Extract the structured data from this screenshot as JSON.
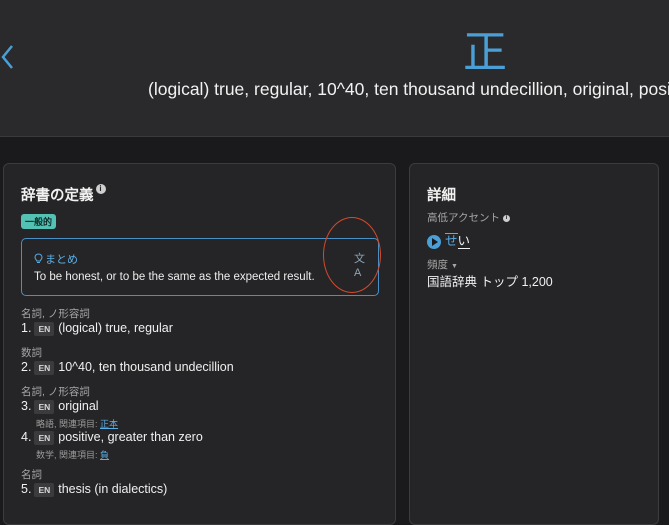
{
  "header": {
    "kanji": "正",
    "gloss": "(logical) true, regular, 10^40, ten thousand undecillion, original, positive, greater than zero"
  },
  "dictionary": {
    "title": "辞書の定義",
    "badge": "一般的",
    "summary_label": "まとめ",
    "summary_text": "To be honest, or to be the same as the expected result.",
    "en_label": "EN",
    "pos": [
      "名詞, ノ形容詞",
      "数詞",
      "名詞, ノ形容詞",
      "名詞"
    ],
    "definitions": [
      {
        "num": "1.",
        "text": "(logical) true, regular"
      },
      {
        "num": "2.",
        "text": "10^40, ten thousand undecillion"
      },
      {
        "num": "3.",
        "text": "original"
      },
      {
        "num": "4.",
        "text": "positive, greater than zero"
      },
      {
        "num": "5.",
        "text": "thesis (in dialectics)"
      }
    ],
    "sub3_prefix": "略語, 関連項目: ",
    "sub3_link": "正本",
    "sub4_prefix": "数学, 関連項目: ",
    "sub4_link": "負"
  },
  "details": {
    "title": "詳細",
    "accent_label": "高低アクセント",
    "accent_hi": "せ",
    "accent_lo": "い",
    "freq_label": "頻度",
    "freq_text": "国語辞典 トップ 1,200"
  },
  "colors": {
    "accent": "#4a9fd6",
    "badge": "#53c2b4",
    "annotation": "#d24a2c"
  },
  "icons": [
    "chevron-left-icon",
    "info-icon",
    "lightbulb-icon",
    "translate-icon",
    "play-icon",
    "caret-down-icon"
  ]
}
